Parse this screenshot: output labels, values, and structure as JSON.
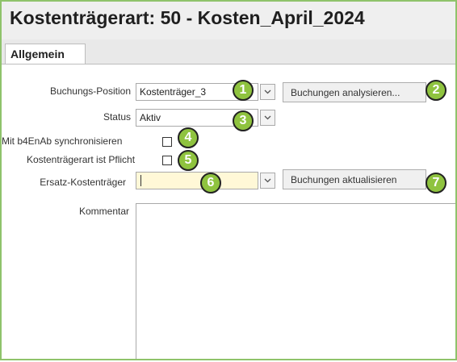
{
  "header": {
    "title": "Kostenträgerart: 50 - Kosten_April_2024"
  },
  "tabs": [
    {
      "label": "Allgemein"
    }
  ],
  "form": {
    "buchungs_position": {
      "label": "Buchungs-Position",
      "value": "Kostenträger_3"
    },
    "status": {
      "label": "Status",
      "value": "Aktiv"
    },
    "sync": {
      "label": "Mit b4EnAb synchronisieren",
      "checked": false
    },
    "pflicht": {
      "label": "Kostenträgerart ist Pflicht",
      "checked": false
    },
    "ersatz": {
      "label": "Ersatz-Kostenträger",
      "value": ""
    },
    "kommentar": {
      "label": "Kommentar",
      "value": ""
    }
  },
  "buttons": {
    "analysieren": "Buchungen analysieren...",
    "aktualisieren": "Buchungen aktualisieren"
  },
  "badges": [
    "1",
    "2",
    "3",
    "4",
    "5",
    "6",
    "7"
  ],
  "colors": {
    "accent": "#8fc33f",
    "frame": "#8fc36b",
    "highlight_field": "#fff8d7"
  }
}
